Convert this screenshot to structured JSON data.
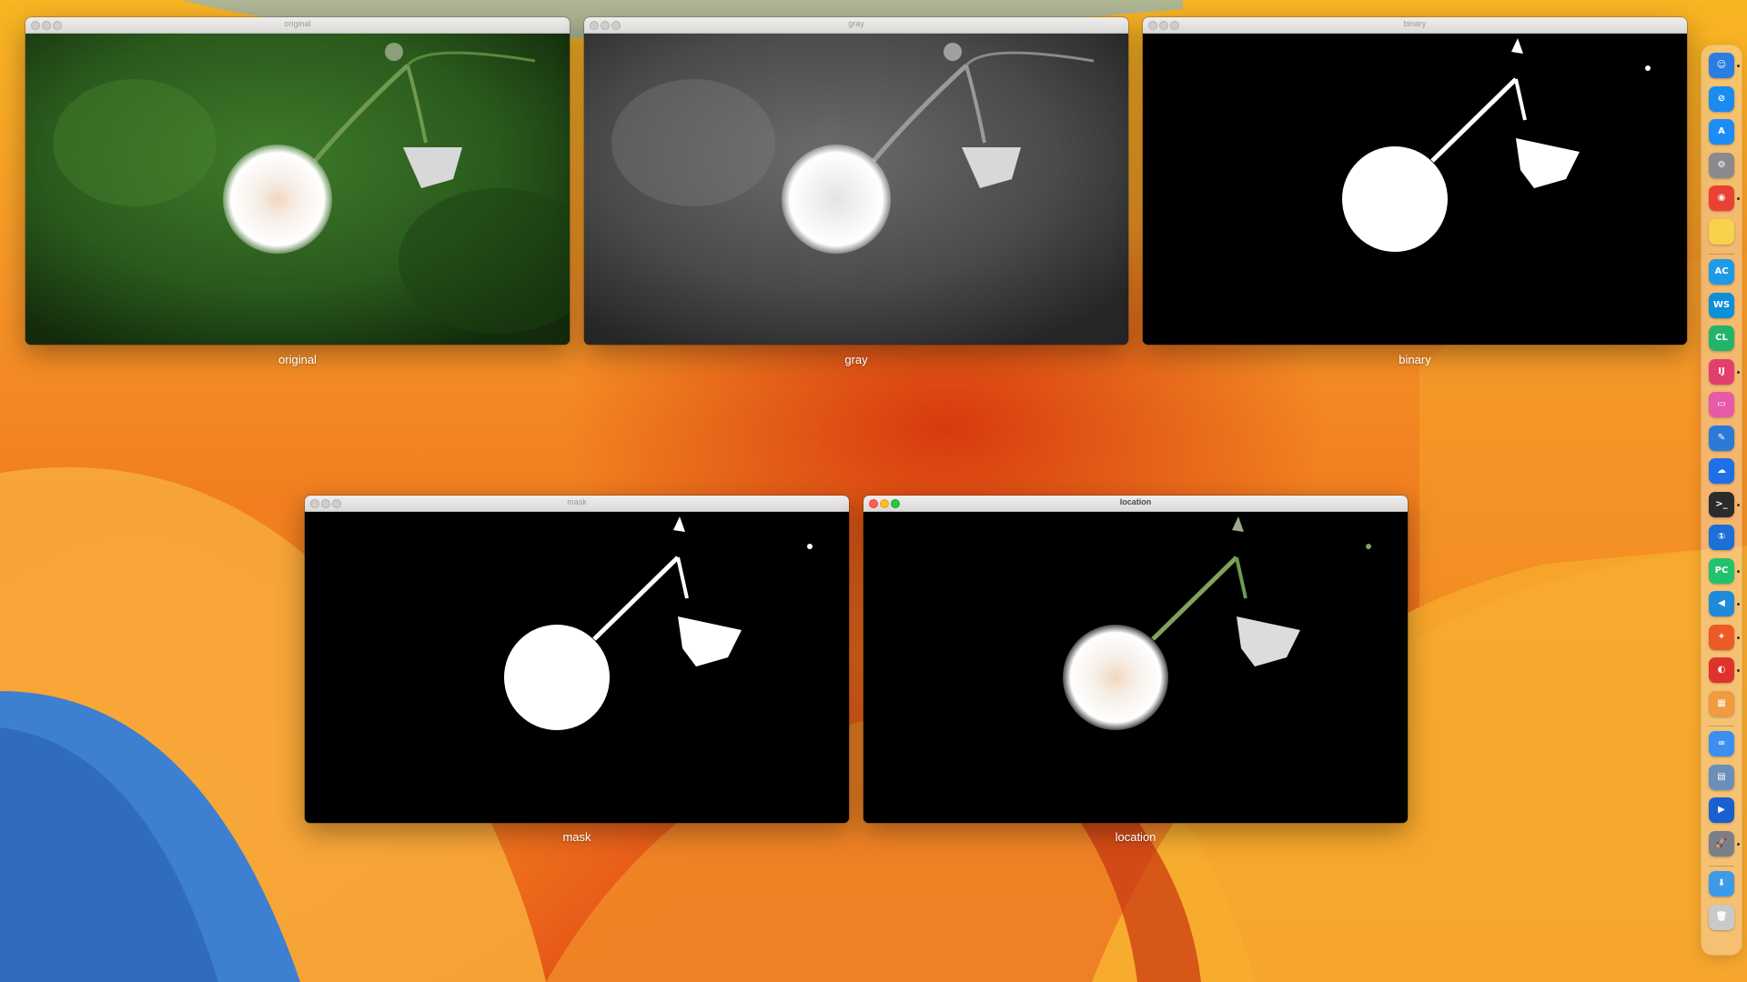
{
  "windows": [
    {
      "title": "original",
      "caption": "original",
      "active": false
    },
    {
      "title": "gray",
      "caption": "gray",
      "active": false
    },
    {
      "title": "binary",
      "caption": "binary",
      "active": false
    },
    {
      "title": "mask",
      "caption": "mask",
      "active": false
    },
    {
      "title": "location",
      "caption": "location",
      "active": true
    }
  ],
  "dock": {
    "items": [
      {
        "name": "finder-icon",
        "glyph": "☺",
        "color": "#2a7de1",
        "running": true
      },
      {
        "name": "safari-icon",
        "glyph": "⊘",
        "color": "#1a8cf0",
        "running": false
      },
      {
        "name": "app-store-icon",
        "glyph": "A",
        "color": "#1d8df5",
        "running": false
      },
      {
        "name": "system-settings-icon",
        "glyph": "⚙",
        "color": "#8a8a8e",
        "running": false
      },
      {
        "name": "chrome-icon",
        "glyph": "◉",
        "color": "#e94235",
        "running": true
      },
      {
        "name": "notes-icon",
        "glyph": "",
        "color": "#f6d34a",
        "running": false
      },
      {
        "name": "appcode-icon",
        "glyph": "AC",
        "color": "#1f9be6",
        "running": false
      },
      {
        "name": "webstorm-icon",
        "glyph": "WS",
        "color": "#0b8fd6",
        "running": false
      },
      {
        "name": "clion-icon",
        "glyph": "CL",
        "color": "#22b56a",
        "running": false
      },
      {
        "name": "intellij-icon",
        "glyph": "IJ",
        "color": "#e23f6f",
        "running": true
      },
      {
        "name": "paw-icon",
        "glyph": "▭",
        "color": "#e65aa8",
        "running": false
      },
      {
        "name": "xcode-icon",
        "glyph": "✎",
        "color": "#2d7ad6",
        "running": false
      },
      {
        "name": "cloud-icon",
        "glyph": "☁",
        "color": "#1e6fe8",
        "running": false
      },
      {
        "name": "terminal-icon",
        "glyph": ">_",
        "color": "#2b2b2b",
        "running": true
      },
      {
        "name": "1password-icon",
        "glyph": "①",
        "color": "#1c6fd6",
        "running": false
      },
      {
        "name": "pycharm-icon",
        "glyph": "PC",
        "color": "#21c26c",
        "running": true
      },
      {
        "name": "vscode-icon",
        "glyph": "◀",
        "color": "#1f8ad9",
        "running": true
      },
      {
        "name": "firefox-icon",
        "glyph": "✦",
        "color": "#ec5b26",
        "running": true
      },
      {
        "name": "recorder-icon",
        "glyph": "◐",
        "color": "#e0322c",
        "running": true
      },
      {
        "name": "launchpad-icon",
        "glyph": "▦",
        "color": "#f19a3e",
        "running": false
      },
      {
        "name": "baidu-netdisk-icon",
        "glyph": "∞",
        "color": "#3a8ff0",
        "running": false
      },
      {
        "name": "preview-icon",
        "glyph": "▤",
        "color": "#6a8fb8",
        "running": false
      },
      {
        "name": "infuse-icon",
        "glyph": "▶",
        "color": "#1a5fcf",
        "running": false
      },
      {
        "name": "rocket-icon",
        "glyph": "🚀",
        "color": "#7a7f88",
        "running": true
      },
      {
        "name": "downloads-folder-icon",
        "glyph": "⬇",
        "color": "#3b9be8",
        "running": false
      },
      {
        "name": "trash-icon",
        "glyph": "🗑",
        "color": "#c9c9cb",
        "running": false
      }
    ]
  }
}
